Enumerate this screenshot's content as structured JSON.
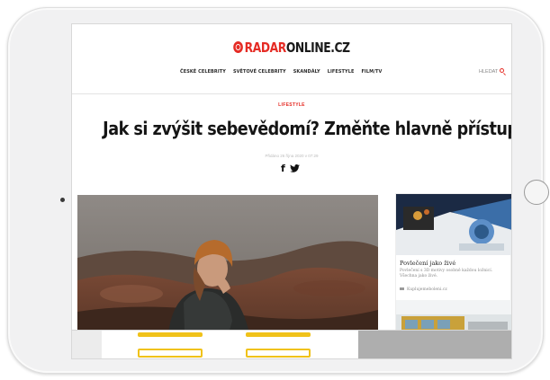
{
  "site": {
    "logo_red": "RADAR",
    "logo_dark": "ONLINE.CZ"
  },
  "nav": {
    "items": [
      {
        "label": "ČESKÉ CELEBRITY"
      },
      {
        "label": "SVĚTOVÉ CELEBRITY"
      },
      {
        "label": "SKANDÁLY"
      },
      {
        "label": "LIFESTYLE"
      },
      {
        "label": "FILM/TV"
      }
    ],
    "search_label": "HLEDAT"
  },
  "article": {
    "category": "LIFESTYLE",
    "headline": "Jak si zvýšit sebevědomí? Změňte hlavně přístup sami k sobě",
    "date": "Přidáno 26 října 2020 v 07:29",
    "share_icons": [
      "facebook-icon",
      "twitter-icon"
    ]
  },
  "ad": {
    "title": "Povlečení jako živé",
    "text": "Povlečení s 3D motivy osobně každou ložnicí. Všechna jako živé.",
    "source": "Kuplujemeboleni.cz"
  },
  "colors": {
    "brand_red": "#e52b24",
    "text_dark": "#151515",
    "accent_yellow": "#f0c21a"
  }
}
